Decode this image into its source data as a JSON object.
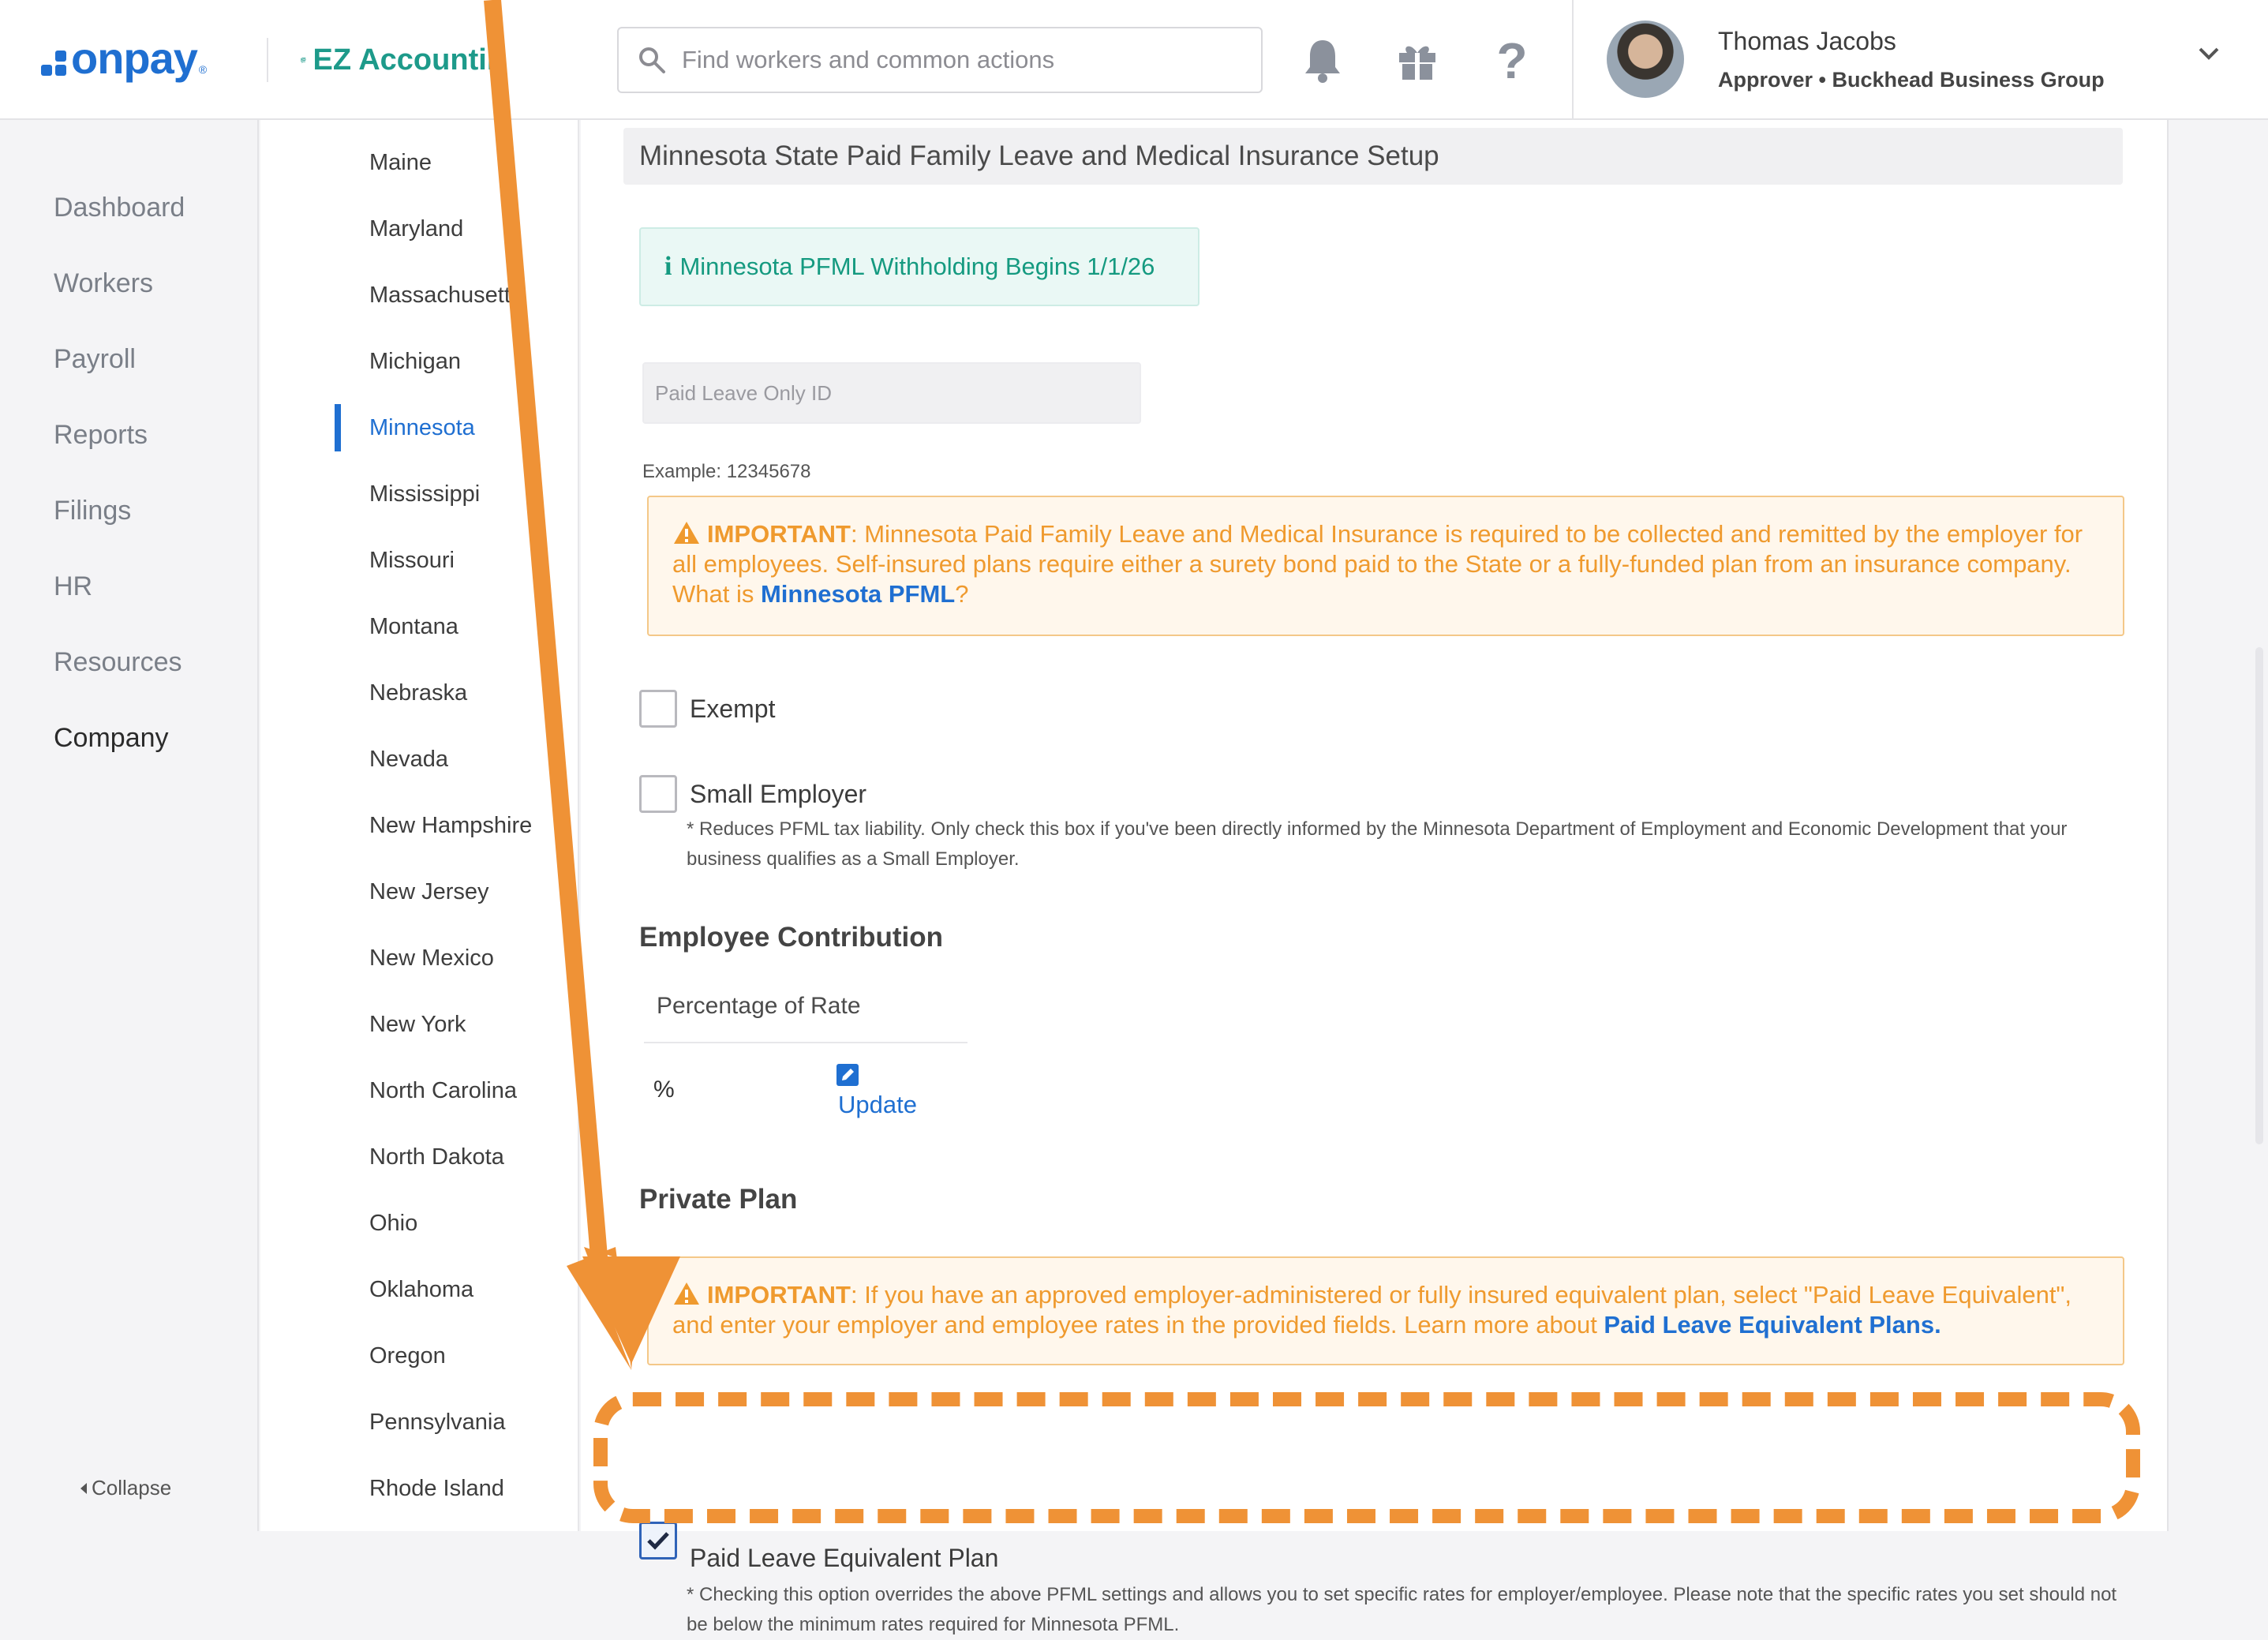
{
  "header": {
    "brand_onpay": "onpay",
    "brand_partner": "EZ Accountin",
    "search_placeholder": "Find workers and common actions",
    "user": {
      "name": "Thomas Jacobs",
      "role": "Approver • Buckhead Business Group"
    }
  },
  "nav": {
    "items": [
      "Dashboard",
      "Workers",
      "Payroll",
      "Reports",
      "Filings",
      "HR",
      "Resources",
      "Company"
    ],
    "active": "Company",
    "collapse_label": "Collapse"
  },
  "states": {
    "items": [
      "Maine",
      "Maryland",
      "Massachusetts",
      "Michigan",
      "Minnesota",
      "Mississippi",
      "Missouri",
      "Montana",
      "Nebraska",
      "Nevada",
      "New Hampshire",
      "New Jersey",
      "New Mexico",
      "New York",
      "North Carolina",
      "North Dakota",
      "Ohio",
      "Oklahoma",
      "Oregon",
      "Pennsylvania",
      "Rhode Island"
    ],
    "active": "Minnesota"
  },
  "main": {
    "section_title": "Minnesota State Paid Family Leave and Medical Insurance Setup",
    "info_banner": "Minnesota PFML Withholding Begins 1/1/26",
    "paid_leave_id_placeholder": "Paid Leave Only ID",
    "example_text": "Example: 12345678",
    "important_1": {
      "label": "IMPORTANT",
      "text": ": Minnesota Paid Family Leave and Medical Insurance is required to be collected and remitted by the employer for all employees. Self-insured plans require either a surety bond paid to the State or a fully-funded plan from an insurance company. What is ",
      "link": "Minnesota PFML",
      "suffix": "?"
    },
    "exempt": {
      "label": "Exempt",
      "checked": false
    },
    "small_employer": {
      "label": "Small Employer",
      "checked": false,
      "note": "* Reduces PFML tax liability. Only check this box if you've been directly informed by the Minnesota Department of Employment and Economic Development that your business qualifies as a Small Employer."
    },
    "employee_contribution": {
      "title": "Employee Contribution",
      "column_header": "Percentage of Rate",
      "value": "%",
      "update_label": "Update"
    },
    "private_plan": {
      "title": "Private Plan",
      "important": {
        "label": "IMPORTANT",
        "text": ": If you have an approved employer-administered or fully insured equivalent plan, select \"Paid Leave Equivalent\", and enter your employer and employee rates in the provided fields. Learn more about ",
        "link": "Paid Leave Equivalent Plans."
      },
      "equivalent_plan": {
        "label": "Paid Leave Equivalent Plan",
        "checked": true,
        "note": "* Checking this option overrides the above PFML settings and allows you to set specific rates for employer/employee. Please note that the specific rates you set should not be below the minimum rates required for Minnesota PFML."
      }
    }
  },
  "colors": {
    "brand_blue": "#1f6fd1",
    "annotation_orange": "#ef9236",
    "warning_orange": "#ef9a2e",
    "success_teal": "#159a80"
  }
}
